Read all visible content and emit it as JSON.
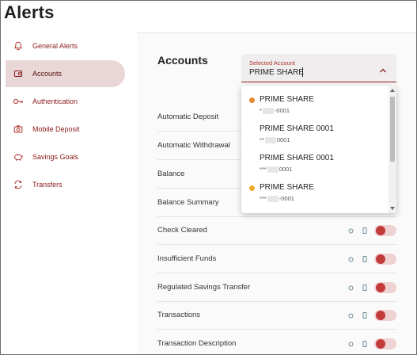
{
  "page": {
    "title": "Alerts"
  },
  "sidebar": {
    "items": [
      {
        "label": "General Alerts",
        "icon": "bell-icon"
      },
      {
        "label": "Accounts",
        "icon": "wallet-icon",
        "active": true
      },
      {
        "label": "Authentication",
        "icon": "key-icon"
      },
      {
        "label": "Mobile Deposit",
        "icon": "camera-icon"
      },
      {
        "label": "Savings Goals",
        "icon": "piggy-bank-icon"
      },
      {
        "label": "Transfers",
        "icon": "transfer-icon"
      }
    ]
  },
  "main": {
    "section_title": "Accounts",
    "select": {
      "label": "Selected Account",
      "value": "PRIME SHARE"
    },
    "dropdown": {
      "options": [
        {
          "name": "PRIME SHARE",
          "prefix": "*",
          "suffix": "-0001",
          "marker": "orange"
        },
        {
          "name": "PRIME SHARE 0001",
          "prefix": "**",
          "suffix": "0001",
          "marker": ""
        },
        {
          "name": "PRIME SHARE 0001",
          "prefix": "***",
          "suffix": "0001",
          "marker": ""
        },
        {
          "name": "PRIME SHARE",
          "prefix": "***",
          "suffix": "-0001",
          "marker": "yellow"
        }
      ]
    },
    "alerts": [
      {
        "label": "Automatic Deposit"
      },
      {
        "label": "Automatic Withdrawal"
      },
      {
        "label": "Balance"
      },
      {
        "label": "Balance Summary"
      },
      {
        "label": "Check Cleared",
        "enabled": false
      },
      {
        "label": "Insufficient Funds",
        "enabled": false
      },
      {
        "label": "Regulated Savings Transfer",
        "enabled": false
      },
      {
        "label": "Transactions",
        "enabled": false
      },
      {
        "label": "Transaction Description",
        "enabled": false
      }
    ]
  },
  "colors": {
    "brand": "#8b1a1a",
    "active_nav_bg": "#e9d6d6",
    "toggle_knob": "#c23b3b",
    "toggle_track": "#efd2d2",
    "marker_orange": "#e4892d",
    "marker_yellow": "#f1a928"
  }
}
